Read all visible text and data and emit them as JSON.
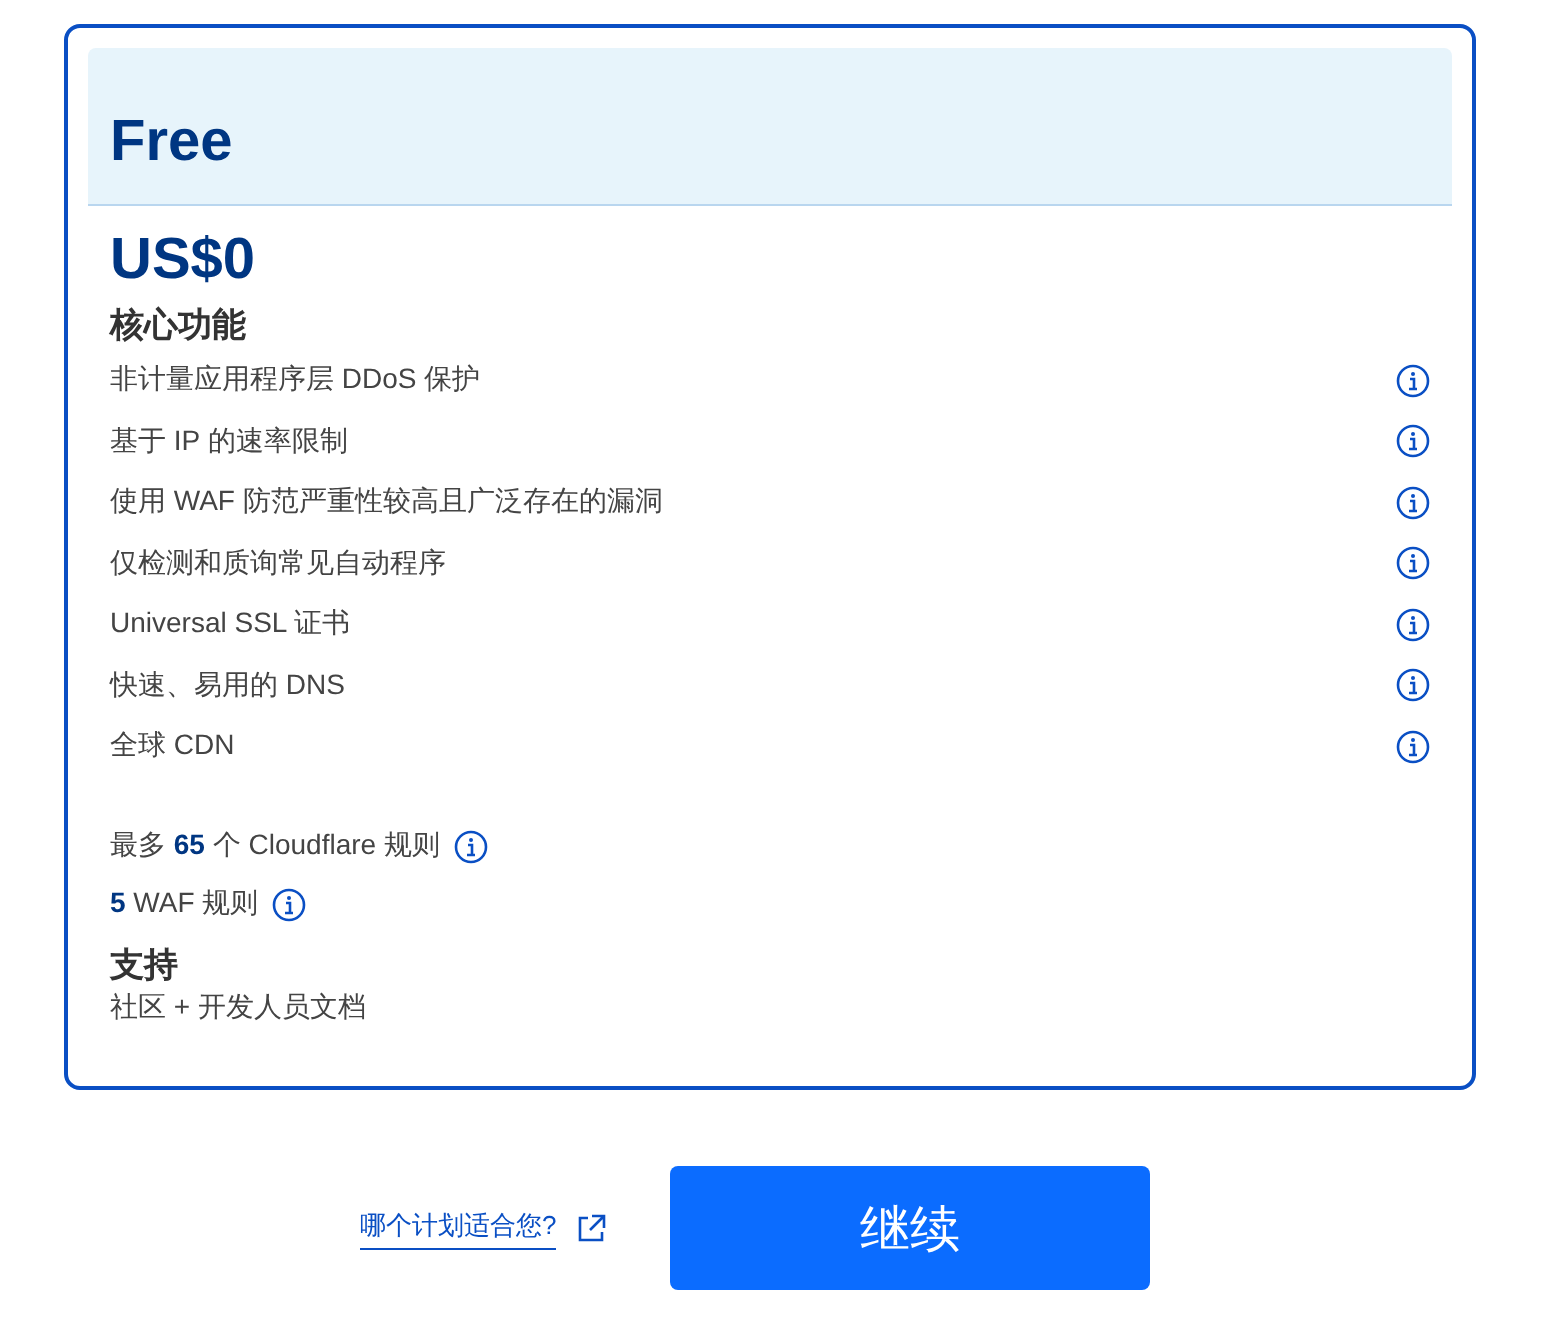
{
  "plan": {
    "name": "Free",
    "price": "US$0"
  },
  "core": {
    "heading": "核心功能",
    "features": [
      "非计量应用程序层 DDoS 保护",
      "基于 IP 的速率限制",
      "使用 WAF 防范严重性较高且广泛存在的漏洞",
      "仅检测和质询常见自动程序",
      "Universal SSL 证书",
      "快速、易用的 DNS",
      "全球 CDN"
    ]
  },
  "limits": [
    "最多 **65** 个 Cloudflare 规则",
    "**5** WAF 规则"
  ],
  "support": {
    "heading": "支持",
    "text": "社区 + 开发人员文档"
  },
  "footer": {
    "link": "哪个计划适合您?",
    "button": "继续"
  }
}
